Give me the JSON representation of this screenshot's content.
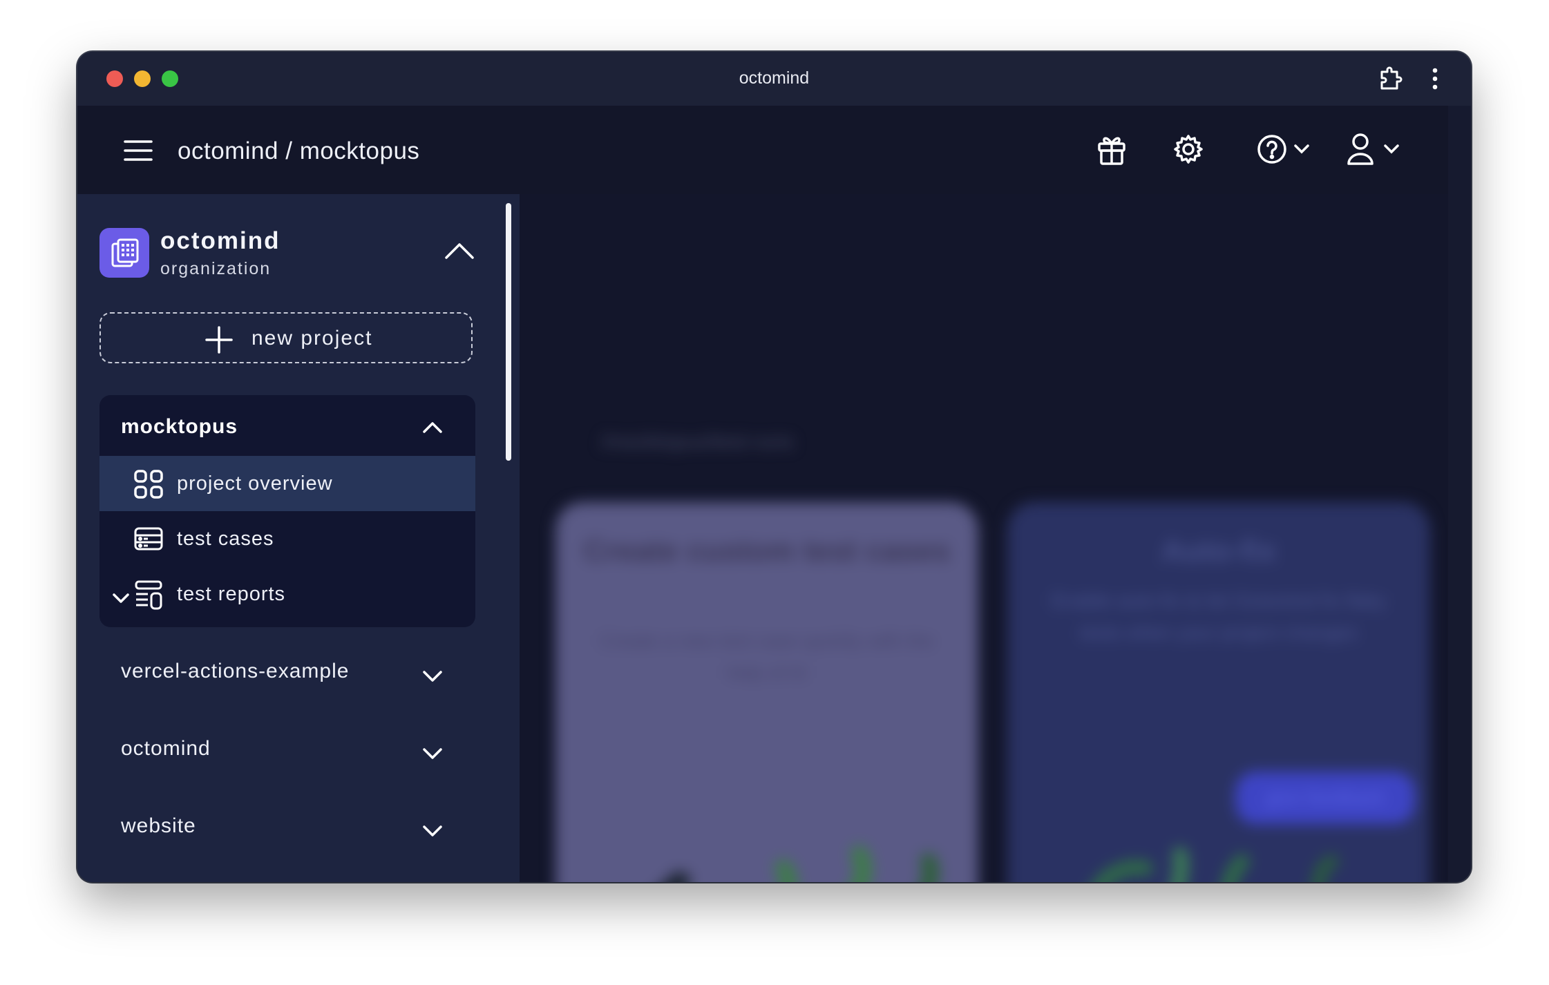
{
  "window": {
    "title": "octomind"
  },
  "header": {
    "breadcrumb": "octomind / mocktopus"
  },
  "sidebar": {
    "organization": {
      "name": "octomind",
      "type": "organization"
    },
    "new_project_label": "new project",
    "active_project": {
      "name": "mocktopus",
      "items": [
        {
          "label": "project overview",
          "icon": "grid-icon",
          "active": true
        },
        {
          "label": "test cases",
          "icon": "test-cases-icon",
          "active": false
        },
        {
          "label": "test reports",
          "icon": "test-reports-icon",
          "active": false
        }
      ]
    },
    "projects": [
      {
        "name": "vercel-actions-example"
      },
      {
        "name": "octomind"
      },
      {
        "name": "website"
      }
    ]
  },
  "main": {
    "path_text": "/mocktopus/test-runs",
    "cards": [
      {
        "title": "Create custom test cases",
        "subtitle": "Create a new test case quickly with the help of AI"
      },
      {
        "title": "Auto-fix",
        "subtitle": "Enable auto-fix to let Octomind fix flaky tests when your project changes",
        "button": "give feedback"
      }
    ]
  },
  "colors": {
    "accent": "#6b5ce7",
    "sidebar": "#1d2440",
    "header": "#131629",
    "active_item": "#273559"
  }
}
